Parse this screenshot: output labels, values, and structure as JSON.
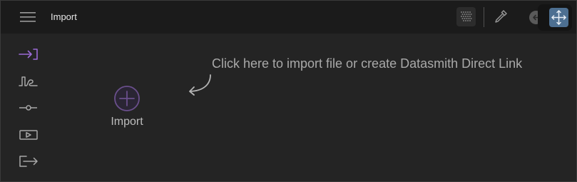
{
  "header": {
    "title": "Import",
    "menu_icon": "hamburger-menu-icon",
    "toolbar": {
      "grid_icon": "dot-grid-icon",
      "color_picker_icon": "eyedropper-icon",
      "back_icon": "arrow-left-circle-icon",
      "move_icon": "move-arrows-icon"
    }
  },
  "sidebar": {
    "items": [
      {
        "icon": "import-arrow-icon",
        "active": true
      },
      {
        "icon": "waveform-curve-icon",
        "active": false
      },
      {
        "icon": "slider-line-icon",
        "active": false
      },
      {
        "icon": "play-box-icon",
        "active": false
      },
      {
        "icon": "export-arrow-icon",
        "active": false
      }
    ]
  },
  "main": {
    "hint": "Click here to import file or create Datasmith Direct Link",
    "import_label": "Import",
    "import_icon": "plus-circle-icon",
    "hint_arrow_icon": "curved-arrow-icon"
  },
  "colors": {
    "accent": "#9b6bd6",
    "topbar": "#1b1b1b",
    "panel": "#242424",
    "move_button": "#4d6f91"
  }
}
